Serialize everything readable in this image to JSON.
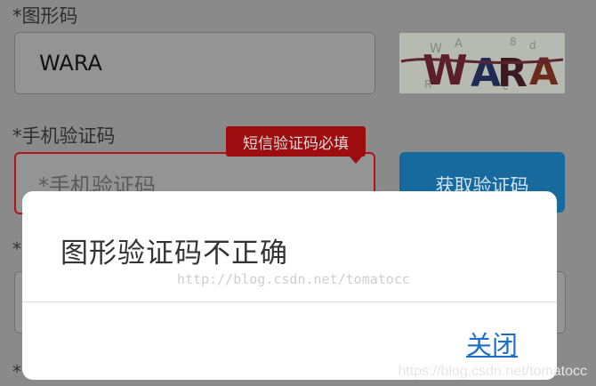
{
  "form": {
    "captcha_label": "*图形码",
    "captcha_value": "WARA",
    "captcha_image_text": "WARA",
    "sms_label": "*手机验证码",
    "sms_placeholder": "*手机验证码",
    "get_code_button": "获取验证码",
    "tooltip": "短信验证码必填",
    "stub_star_1": "*",
    "stub_star_2": "*"
  },
  "dialog": {
    "message": "图形验证码不正确",
    "close_label": "关闭"
  },
  "watermarks": {
    "center": "http://blog.csdn.net/tomatocc",
    "corner": "https://blog.csdn.net/tomatocc"
  },
  "colors": {
    "error": "#b01414",
    "button": "#176a9e",
    "link": "#1b6fc9"
  }
}
